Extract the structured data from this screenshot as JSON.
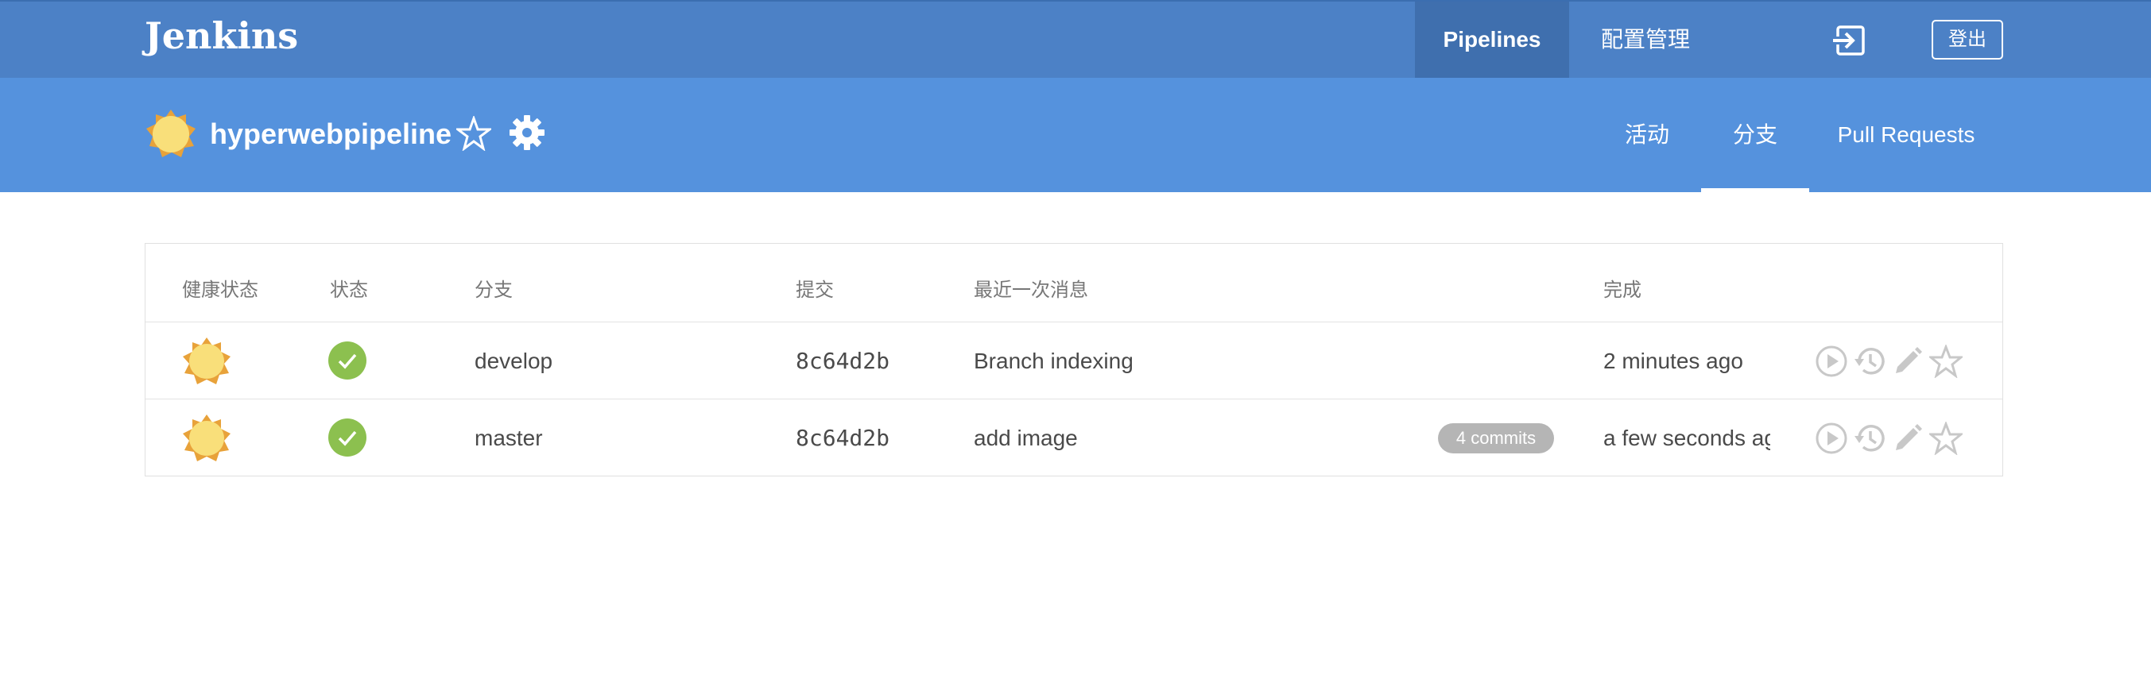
{
  "header": {
    "logo": "Jenkins",
    "nav": {
      "pipelines": "Pipelines",
      "admin": "配置管理"
    },
    "logout_label": "登出"
  },
  "pipeline": {
    "name": "hyperwebpipeline",
    "tabs": {
      "activity": "活动",
      "branches": "分支",
      "pull_requests": "Pull Requests"
    }
  },
  "table": {
    "headers": {
      "health": "健康状态",
      "status": "状态",
      "branch": "分支",
      "commit": "提交",
      "message": "最近一次消息",
      "completed": "完成"
    },
    "rows": [
      {
        "branch": "develop",
        "commit": "8c64d2b",
        "message": "Branch indexing",
        "badge": "",
        "completed": "2 minutes ago"
      },
      {
        "branch": "master",
        "commit": "8c64d2b",
        "message": "add image",
        "badge": "4 commits",
        "completed": "a few seconds ago"
      }
    ]
  },
  "colors": {
    "topbar": "#4c81c6",
    "subbar": "#5592dd",
    "success": "#8cc04f",
    "sun": "#f7d769"
  }
}
